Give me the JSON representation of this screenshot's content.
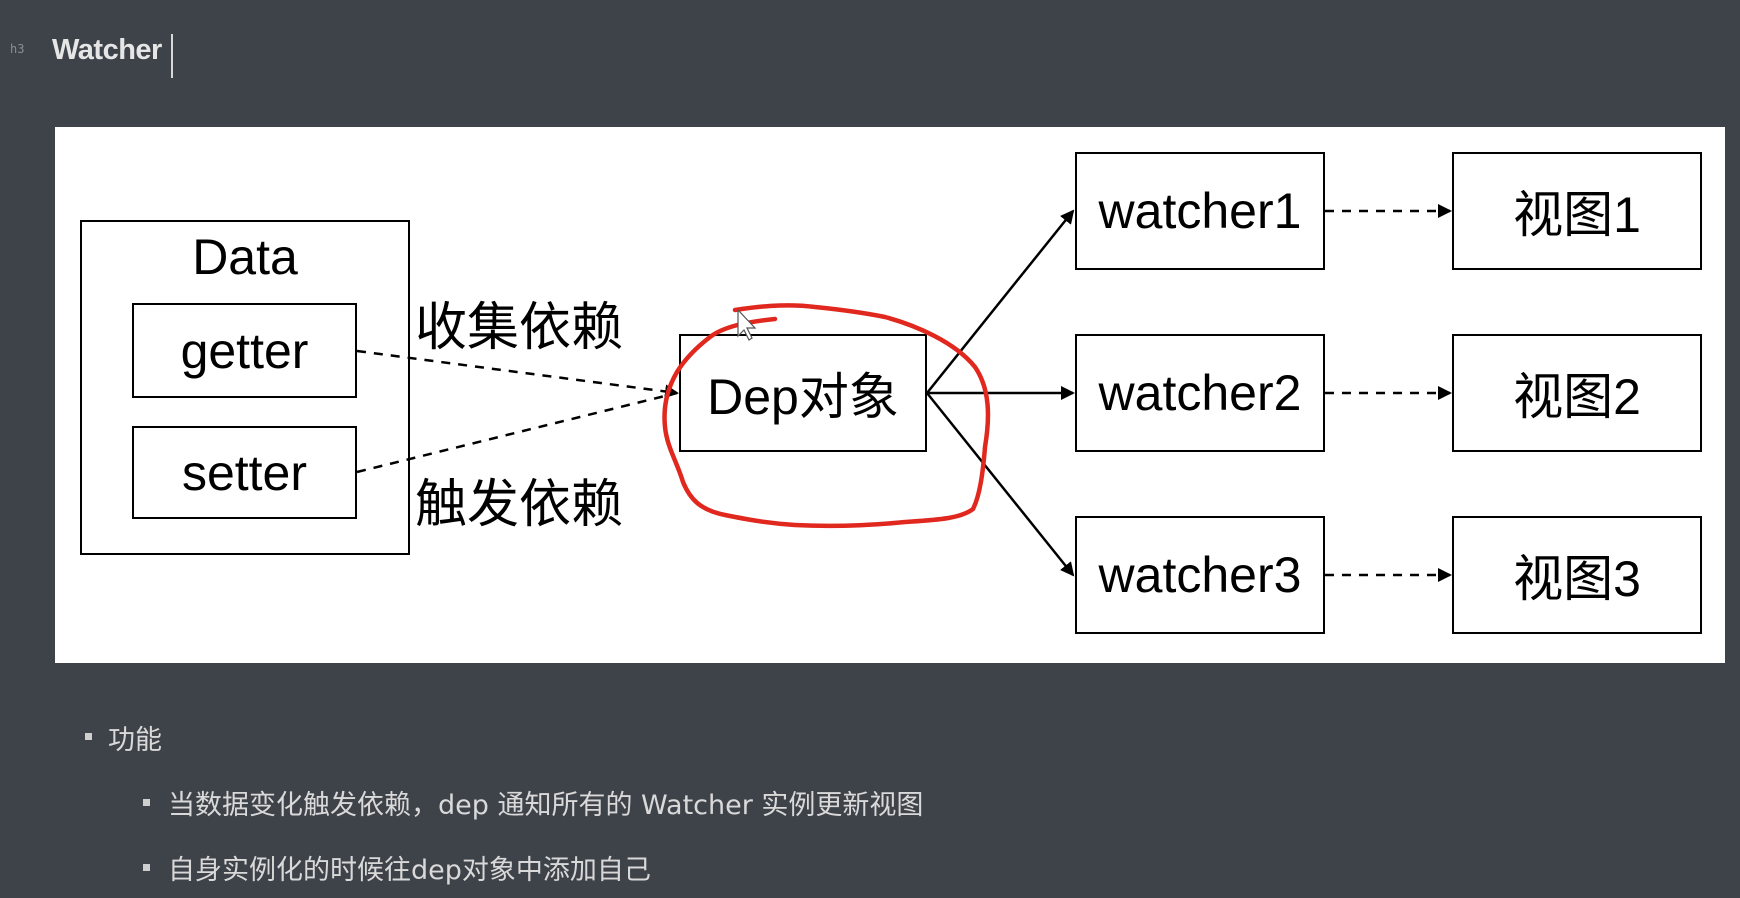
{
  "heading": {
    "marker": "h3",
    "title": "Watcher"
  },
  "diagram": {
    "data_box": {
      "title": "Data",
      "getter": "getter",
      "setter": "setter"
    },
    "edge_labels": {
      "collect": "收集依赖",
      "trigger": "触发依赖"
    },
    "dep": "Dep对象",
    "watchers": [
      "watcher1",
      "watcher2",
      "watcher3"
    ],
    "views": [
      "视图1",
      "视图2",
      "视图3"
    ],
    "highlight_color": "#e0281e"
  },
  "list": {
    "item": "功能",
    "subitems": [
      "当数据变化触发依赖，dep 通知所有的 Watcher 实例更新视图",
      "自身实例化的时候往dep对象中添加自己"
    ]
  }
}
